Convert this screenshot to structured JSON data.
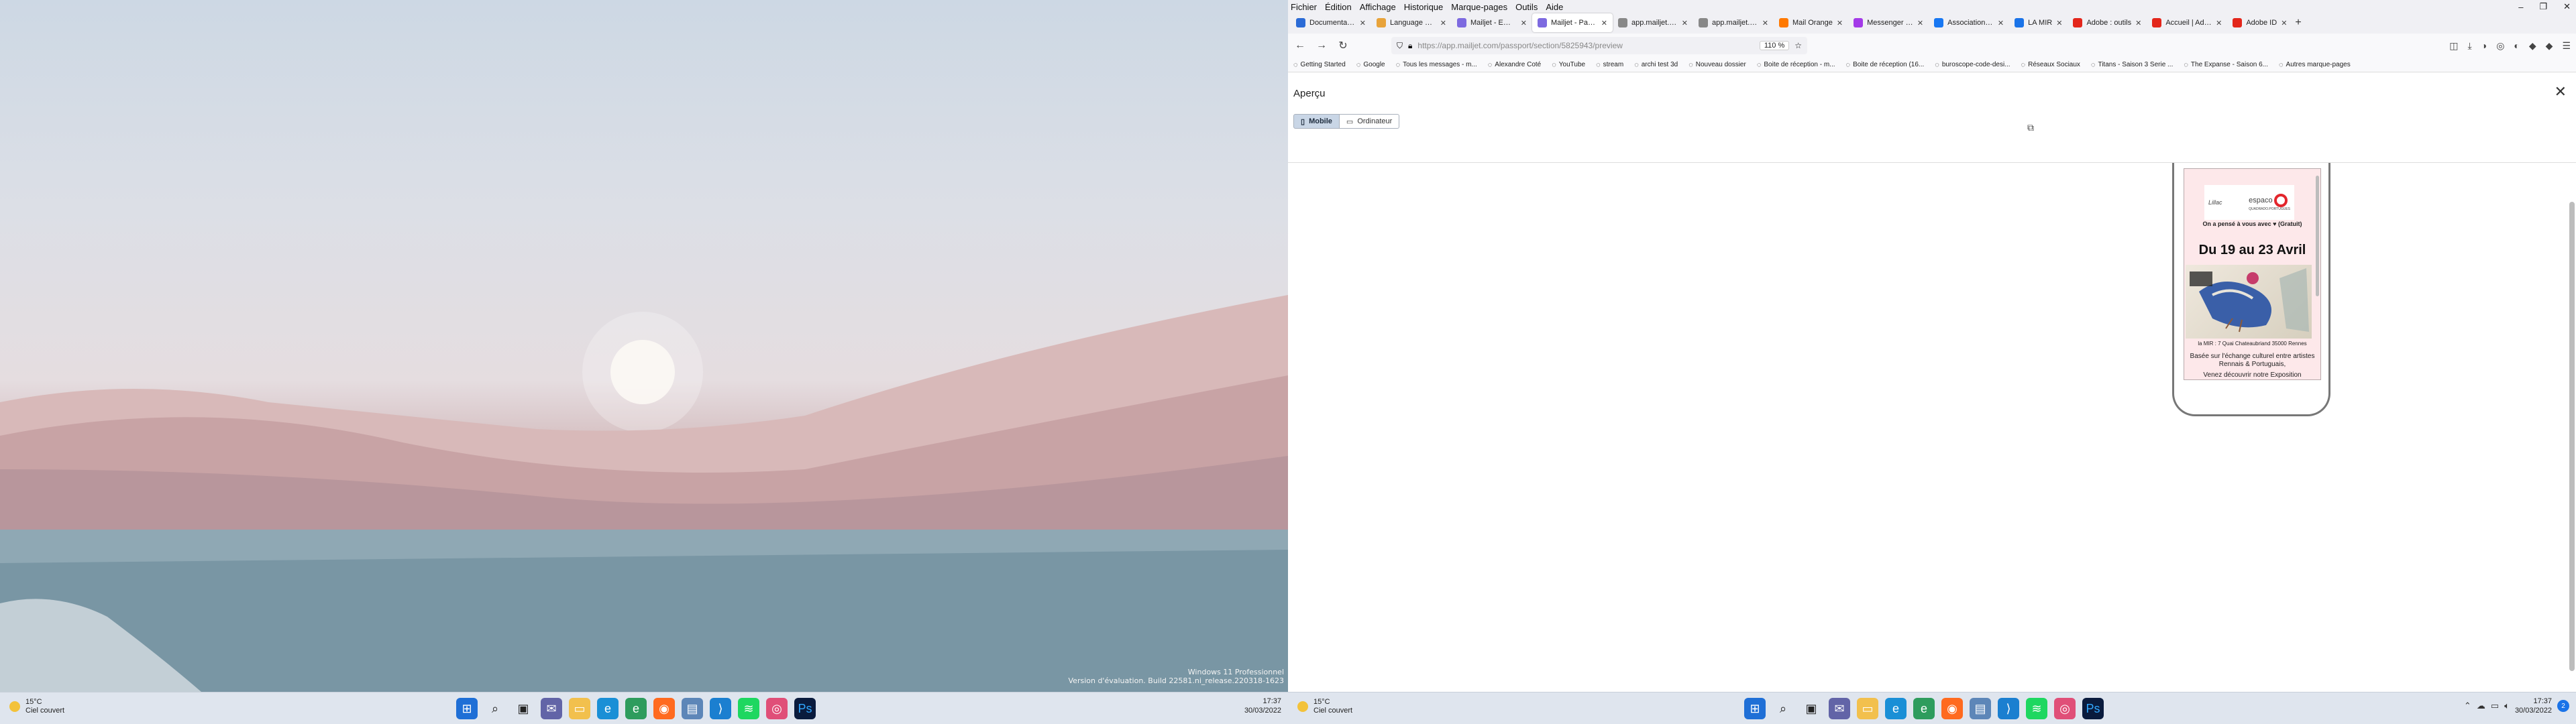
{
  "desktop": {
    "watermark_line1": "Windows 11 Professionnel",
    "watermark_line2": "Version d'évaluation. Build 22581.ni_release.220318-1623"
  },
  "taskbar": {
    "weather_temp": "15°C",
    "weather_desc": "Ciel couvert",
    "time": "17:37",
    "date": "30/03/2022",
    "notif_count": "2",
    "icons": [
      "start-icon",
      "search-icon",
      "taskview-icon",
      "chat-icon",
      "explorer-icon",
      "edge-icon",
      "edge-dev-icon",
      "firefox-icon",
      "photos-icon",
      "vscode-icon",
      "spotify-icon",
      "davinci-icon",
      "photoshop-icon"
    ]
  },
  "browser": {
    "menu": [
      "Fichier",
      "Édition",
      "Affichage",
      "Historique",
      "Marque-pages",
      "Outils",
      "Aide"
    ],
    "tabs": [
      {
        "label": "Documentation",
        "color": "#2b6bd6"
      },
      {
        "label": "Language Pack",
        "color": "#e8a33a"
      },
      {
        "label": "Mailjet - Emails",
        "color": "#7d6ae0"
      },
      {
        "label": "Mailjet - Passport",
        "color": "#7d6ae0",
        "active": true
      },
      {
        "label": "app.mailjet.com/pa",
        "color": "#888888"
      },
      {
        "label": "app.mailjet.com/pa",
        "color": "#888888"
      },
      {
        "label": "Mail Orange",
        "color": "#ff7900"
      },
      {
        "label": "Messenger | Fa",
        "color": "#a33ae8"
      },
      {
        "label": "Association L.V",
        "color": "#1877f2"
      },
      {
        "label": "LA MIR",
        "color": "#1a73e8"
      },
      {
        "label": "Adobe : outils",
        "color": "#e3261b"
      },
      {
        "label": "Accueil | Adobe",
        "color": "#e3261b"
      },
      {
        "label": "Adobe ID",
        "color": "#e3261b"
      }
    ],
    "url": "https://app.mailjet.com/passport/section/5825943/preview",
    "zoom": "110 %",
    "bookmarks": [
      "Getting Started",
      "Google",
      "Tous les messages - m...",
      "Alexandre Coté",
      "YouTube",
      "stream",
      "archi test 3d",
      "Nouveau dossier",
      "Boite de réception - m...",
      "Boite de réception (16...",
      "buroscope-code-desi...",
      "Réseaux Sociaux",
      "Titans - Saison 3 Serie ...",
      "The Expanse - Saison 6...",
      "Autres marque-pages"
    ]
  },
  "dialog": {
    "title": "Aperçu",
    "mobile_label": "Mobile",
    "desktop_label": "Ordinateur"
  },
  "email": {
    "brand_left": "Lillac",
    "brand_right": "espaco",
    "brand_sub": "QUADRADO.PORTUGUES",
    "tagline": "On a pensé à vous avec ♥ (Gratuit)",
    "dates": "Du 19 au 23 Avril",
    "address": "la MIR : 7 Quai Chateaubriand 35000 Rennes",
    "body1": "Basée sur l'échange culturel entre artistes Rennais & Portuguais,",
    "body2": "Venez découvrir notre Exposition"
  }
}
